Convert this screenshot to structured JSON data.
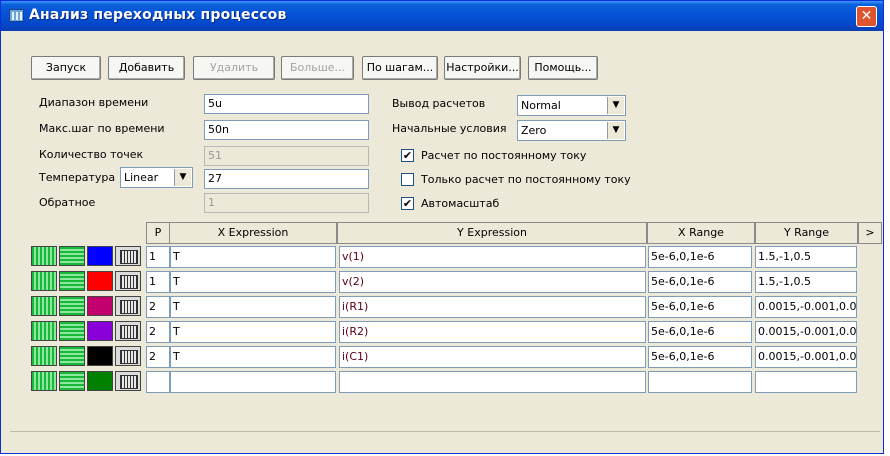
{
  "window": {
    "title": "Анализ переходных процессов"
  },
  "toolbar": {
    "buttons": [
      {
        "label": "Запуск",
        "enabled": true
      },
      {
        "label": "Добавить",
        "enabled": true
      },
      {
        "label": "Удалить",
        "enabled": false
      },
      {
        "label": "Больше...",
        "enabled": false
      },
      {
        "label": "По шагам...",
        "enabled": true
      },
      {
        "label": "Настройки...",
        "enabled": true
      },
      {
        "label": "Помощь...",
        "enabled": true
      }
    ]
  },
  "params": {
    "time_range": {
      "label": "Диапазон времени",
      "value": "5u"
    },
    "max_step": {
      "label": "Макс.шаг по времени",
      "value": "50n"
    },
    "num_points": {
      "label": "Количество точек",
      "value": "51"
    },
    "temperature": {
      "label": "Температура",
      "mode": "Linear",
      "value": "27"
    },
    "reverse": {
      "label": "Обратное",
      "value": "1"
    },
    "output": {
      "label": "Вывод расчетов",
      "value": "Normal"
    },
    "initial": {
      "label": "Начальные условия",
      "value": "Zero"
    },
    "dc_calc": {
      "label": "Расчет по постоянному току",
      "checked": true,
      "mark": "✔"
    },
    "dc_only": {
      "label": "Только расчет по постоянному току",
      "checked": false,
      "mark": ""
    },
    "autoscale": {
      "label": "Автомасштаб",
      "checked": true,
      "mark": "✔"
    }
  },
  "grid": {
    "headers": {
      "p": "P",
      "x": "X Expression",
      "y": "Y Expression",
      "xr": "X Range",
      "yr": "Y Range",
      "more": ">"
    },
    "rows": [
      {
        "color": "#0000ff",
        "p": "1",
        "x": "T",
        "y": "v(1)",
        "xr": "5e-6,0,1e-6",
        "yr": "1.5,-1,0.5"
      },
      {
        "color": "#ff0000",
        "p": "1",
        "x": "T",
        "y": "v(2)",
        "xr": "5e-6,0,1e-6",
        "yr": "1.5,-1,0.5"
      },
      {
        "color": "#c2006e",
        "p": "2",
        "x": "T",
        "y": "i(R1)",
        "xr": "5e-6,0,1e-6",
        "yr": "0.0015,-0.001,0.0"
      },
      {
        "color": "#8a00d8",
        "p": "2",
        "x": "T",
        "y": "i(R2)",
        "xr": "5e-6,0,1e-6",
        "yr": "0.0015,-0.001,0.0"
      },
      {
        "color": "#000000",
        "p": "2",
        "x": "T",
        "y": "i(C1)",
        "xr": "5e-6,0,1e-6",
        "yr": "0.0015,-0.001,0.0"
      },
      {
        "color": "#008000",
        "p": "",
        "x": "",
        "y": "",
        "xr": "",
        "yr": ""
      }
    ]
  }
}
